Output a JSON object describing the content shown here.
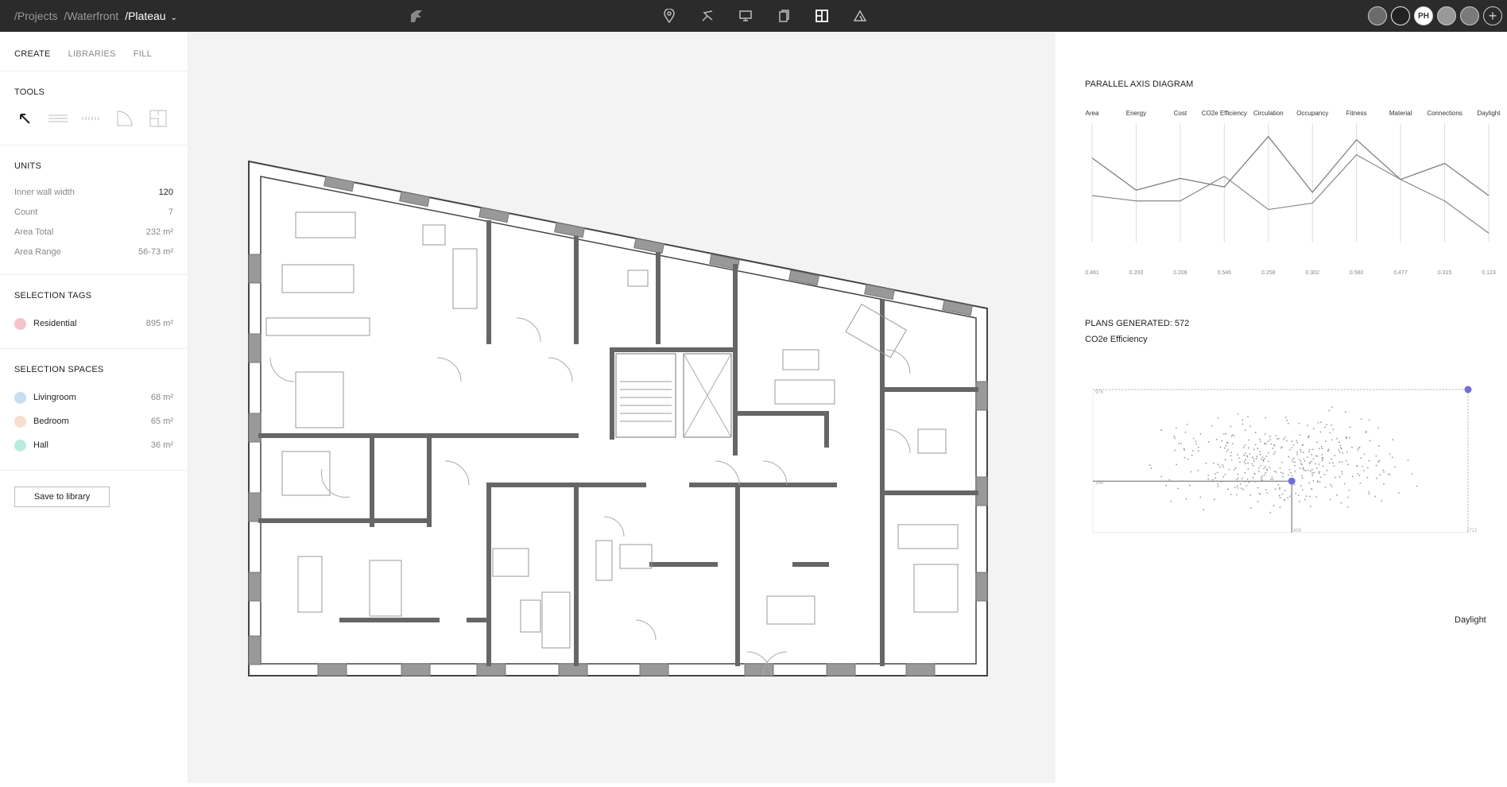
{
  "breadcrumb": {
    "projects": "/Projects",
    "waterfront": "/Waterfront",
    "current": "/Plateau",
    "chevron": "⌄"
  },
  "top_icons": [
    "location-pin-icon",
    "route-icon",
    "monitor-icon",
    "copy-icon",
    "layout-icon",
    "triangle-icon"
  ],
  "avatars": [
    {
      "label": ""
    },
    {
      "label": ""
    },
    {
      "label": "PH"
    },
    {
      "label": ""
    },
    {
      "label": ""
    },
    {
      "label": "+"
    }
  ],
  "tabs": {
    "create": "CREATE",
    "libraries": "LIBRARIES",
    "fill": "FILL"
  },
  "tools": {
    "title": "TOOLS",
    "items": [
      "arrow-icon",
      "wall-icon",
      "dashed-wall-icon",
      "door-icon",
      "room-icon"
    ]
  },
  "units": {
    "title": "UNITS",
    "rows": [
      {
        "label": "Inner wall width",
        "value": "120"
      },
      {
        "label": "Count",
        "value": "7"
      },
      {
        "label": "Area Total",
        "value": "232 m²"
      },
      {
        "label": "Area Range",
        "value": "56-73 m²"
      }
    ]
  },
  "selection_tags": {
    "title": "SELECTION TAGS",
    "items": [
      {
        "label": "Residential",
        "area": "895 m²",
        "color": "#f5c3c8"
      }
    ]
  },
  "selection_spaces": {
    "title": "SELECTION SPACES",
    "items": [
      {
        "label": "Livingroom",
        "area": "68 m²",
        "color": "#c6def0"
      },
      {
        "label": "Bedroom",
        "area": "65 m²",
        "color": "#f7dfcf"
      },
      {
        "label": "Hall",
        "area": "36 m²",
        "color": "#b9ecdf"
      }
    ]
  },
  "save_button": "Save to library",
  "parallel": {
    "title": "PARALLEL AXIS DIAGRAM"
  },
  "plans": {
    "title": "PLANS GENERATED: 572",
    "metric": "CO2e Efficiency",
    "xlabel": "Daylight"
  },
  "chart_data": [
    {
      "type": "line",
      "title": "PARALLEL AXIS DIAGRAM",
      "categories": [
        "Area",
        "Energy",
        "Cost",
        "CO2e Efficiency",
        "Circulation",
        "Occupancy",
        "Fitness",
        "Material",
        "Connections",
        "Daylight"
      ],
      "bottom_values": [
        "0.481",
        "0.203",
        "0.208",
        "0.546",
        "0.258",
        "0.302",
        "0.580",
        "0.477",
        "0.315",
        "0.123"
      ],
      "series": [
        {
          "values": [
            0.75,
            0.45,
            0.56,
            0.48,
            0.95,
            0.43,
            0.92,
            0.55,
            0.7,
            0.4
          ]
        },
        {
          "values": [
            0.4,
            0.35,
            0.35,
            0.58,
            0.27,
            0.33,
            0.78,
            0.55,
            0.35,
            0.05
          ]
        }
      ]
    },
    {
      "type": "scatter",
      "title": "PLANS GENERATED: 572",
      "ylabel": "CO2e Efficiency",
      "xlabel": "Daylight",
      "y_top_label": "976",
      "y_sel_label": "356",
      "x_sel_label": "803",
      "x_max_label": "1712",
      "selected": {
        "x": 0.53,
        "y": 0.36
      },
      "max": {
        "x": 1,
        "y": 1
      }
    }
  ]
}
